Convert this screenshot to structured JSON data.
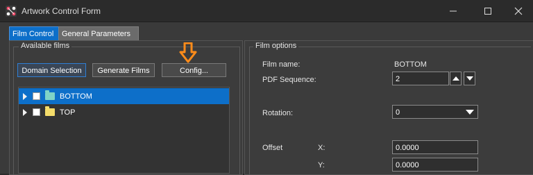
{
  "window": {
    "title": "Artwork Control Form"
  },
  "tabs": [
    {
      "label": "Film Control",
      "active": true
    },
    {
      "label": "General Parameters",
      "active": false
    }
  ],
  "available_films": {
    "legend": "Available films",
    "buttons": {
      "domain_selection": "Domain Selection",
      "generate_films": "Generate Films",
      "config": "Config..."
    },
    "tree": [
      {
        "label": "BOTTOM",
        "selected": true,
        "checked": false,
        "folder_color": "#7fd3c7"
      },
      {
        "label": "TOP",
        "selected": false,
        "checked": false,
        "folder_color": "#f4dc6a"
      }
    ]
  },
  "film_options": {
    "legend": "Film options",
    "film_name_label": "Film name:",
    "film_name_value": "BOTTOM",
    "pdf_sequence_label": "PDF Sequence:",
    "pdf_sequence_value": "2",
    "rotation_label": "Rotation:",
    "rotation_value": "0",
    "offset_label": "Offset",
    "offset_x_label": "X:",
    "offset_x_value": "0.0000",
    "offset_y_label": "Y:",
    "offset_y_value": "0.0000"
  },
  "annotation": {
    "icon": "orange-down-arrow-icon",
    "color": "#ff8c1a"
  },
  "colors": {
    "accent": "#0d6fc9",
    "background": "#3a3a3a"
  }
}
